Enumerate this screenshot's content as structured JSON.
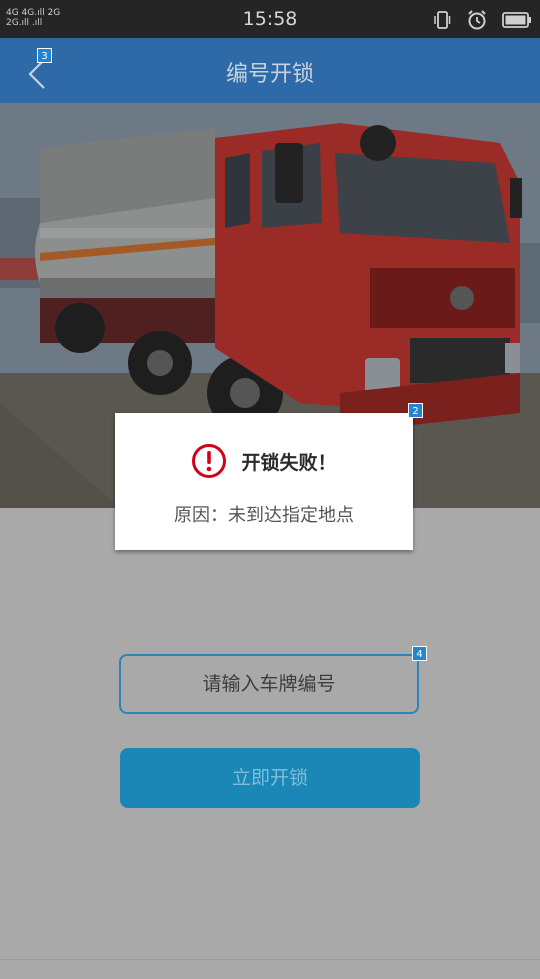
{
  "status_bar": {
    "network_line1": "4G 4G.ıll 2G",
    "network_line2": "2G.ıll .ıll",
    "time": "15:58"
  },
  "header": {
    "title": "编号开锁",
    "back_badge": "3"
  },
  "dialog": {
    "badge": "2",
    "title": "开锁失败！",
    "reason": "原因：未到达指定地点",
    "icon_color": "#d0021b"
  },
  "form": {
    "plate_placeholder": "请输入车牌编号",
    "plate_badge": "4",
    "unlock_label": "立即开锁"
  },
  "colors": {
    "header_bg": "#2f6aa8",
    "accent": "#1b87b6",
    "overlay_bg": "#a9a9a9"
  }
}
